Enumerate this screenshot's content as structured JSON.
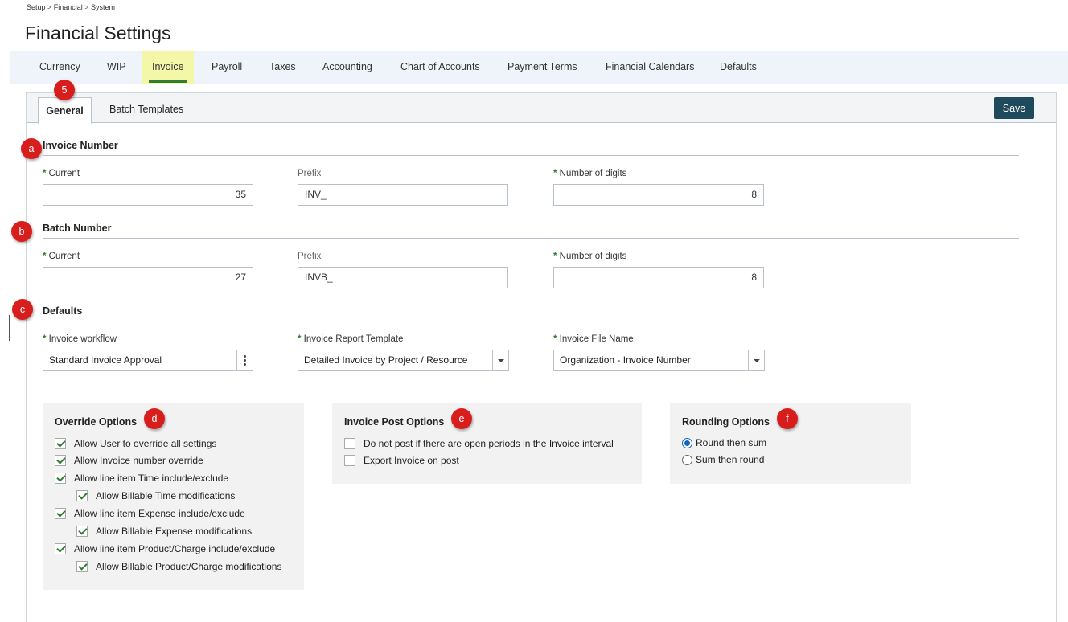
{
  "breadcrumb": "Setup > Financial > System",
  "page_title": "Financial Settings",
  "top_tabs": [
    "Currency",
    "WIP",
    "Invoice",
    "Payroll",
    "Taxes",
    "Accounting",
    "Chart of Accounts",
    "Payment Terms",
    "Financial Calendars",
    "Defaults"
  ],
  "active_top_tab": "Invoice",
  "sub_tabs": [
    "General",
    "Batch Templates"
  ],
  "active_sub_tab": "General",
  "save_label": "Save",
  "invoice_number": {
    "title": "Invoice Number",
    "current_label": "Current",
    "current_value": "35",
    "prefix_label": "Prefix",
    "prefix_value": "INV_",
    "digits_label": "Number of digits",
    "digits_value": "8"
  },
  "batch_number": {
    "title": "Batch Number",
    "current_label": "Current",
    "current_value": "27",
    "prefix_label": "Prefix",
    "prefix_value": "INVB_",
    "digits_label": "Number of digits",
    "digits_value": "8"
  },
  "defaults": {
    "title": "Defaults",
    "workflow_label": "Invoice workflow",
    "workflow_value": "Standard Invoice Approval",
    "report_label": "Invoice Report Template",
    "report_value": "Detailed Invoice by Project / Resource",
    "file_label": "Invoice File Name",
    "file_value": "Organization - Invoice Number"
  },
  "override_options": {
    "title": "Override Options",
    "items": [
      {
        "label": "Allow User to override all settings",
        "checked": true
      },
      {
        "label": "Allow Invoice number override",
        "checked": true
      },
      {
        "label": "Allow line item Time include/exclude",
        "checked": true
      },
      {
        "label": "Allow Billable Time modifications",
        "checked": true
      },
      {
        "label": "Allow line item Expense include/exclude",
        "checked": true
      },
      {
        "label": "Allow Billable Expense modifications",
        "checked": true
      },
      {
        "label": "Allow line item Product/Charge include/exclude",
        "checked": true
      },
      {
        "label": "Allow Billable Product/Charge modifications",
        "checked": true
      }
    ]
  },
  "post_options": {
    "title": "Invoice Post Options",
    "items": [
      {
        "label": "Do not post if there are open periods in the Invoice interval",
        "checked": false
      },
      {
        "label": "Export Invoice on post",
        "checked": false
      }
    ]
  },
  "rounding_options": {
    "title": "Rounding Options",
    "items": [
      {
        "label": "Round then sum",
        "selected": true
      },
      {
        "label": "Sum then round",
        "selected": false
      }
    ]
  },
  "callouts": [
    "5",
    "a",
    "b",
    "c",
    "d",
    "e",
    "f"
  ],
  "colors": {
    "accent_green": "#2e7d32",
    "save_button": "#1f4a5c",
    "callout_red": "#d81d1d",
    "active_tab_highlight": "#f4f6a8"
  }
}
